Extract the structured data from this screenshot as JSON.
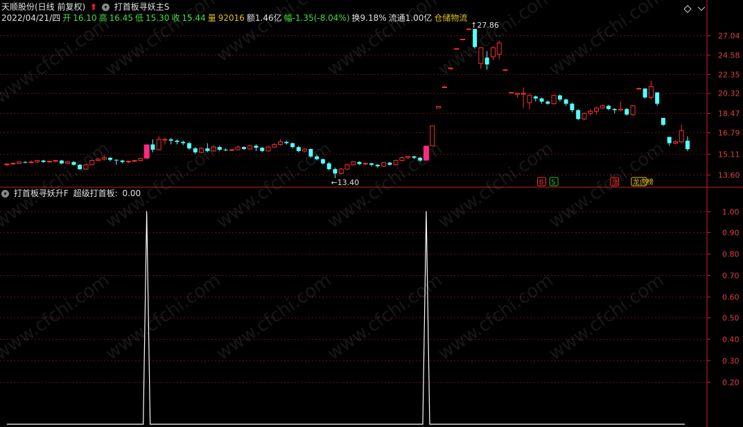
{
  "header": {
    "stock": "天顺股份(日线 前复权)",
    "indicator_main": "打首板寻妖主S",
    "date": "2022/04/21/四",
    "open_label": "开",
    "open": "16.10",
    "high_label": "高",
    "high": "16.45",
    "low_label": "低",
    "low": "15.30",
    "close_label": "收",
    "close": "15.44",
    "vol_label": "量",
    "vol": "92016",
    "amount": "额1.46亿",
    "change": "幅-1.35(-8.04%)",
    "turnover": "换9.18%",
    "float": "流通1.00亿",
    "sector": "仓储物流"
  },
  "sub_header": {
    "indicator": "打首板寻妖升F",
    "param_label": "超级打首板:",
    "param_value": "0.00"
  },
  "colors": {
    "up": "#ff3030",
    "down": "#55ffff",
    "limit": "#ff2a80",
    "axis": "#cc2020",
    "grid": "#6a1010",
    "line": "#ffffff"
  },
  "chart_data": [
    {
      "type": "candlestick",
      "title": "打首板寻妖主S",
      "ylim": [
        12.9,
        28.8
      ],
      "y_ticks": [
        27.04,
        24.58,
        22.35,
        20.32,
        18.47,
        16.79,
        15.11,
        13.6
      ],
      "annotations": [
        {
          "text": "↑27.86",
          "bar": 77
        },
        {
          "text": "←13.40",
          "bar": 54
        }
      ],
      "signals": [
        {
          "text": "B",
          "bar": 88,
          "color": "#ff3030"
        },
        {
          "text": "S",
          "bar": 90,
          "color": "#30c030"
        },
        {
          "text": "涨",
          "bar": 100,
          "color": "#ff3030"
        },
        {
          "text": "龙虎榜",
          "bar": 104,
          "color": "#e0c020"
        }
      ],
      "candles": [
        [
          14.3,
          14.35,
          14.2,
          14.4
        ],
        [
          14.35,
          14.4,
          14.3,
          14.45
        ],
        [
          14.4,
          14.5,
          14.35,
          14.55
        ],
        [
          14.5,
          14.45,
          14.4,
          14.55
        ],
        [
          14.45,
          14.5,
          14.4,
          14.6
        ],
        [
          14.5,
          14.6,
          14.45,
          14.65
        ],
        [
          14.6,
          14.5,
          14.45,
          14.65
        ],
        [
          14.5,
          14.55,
          14.45,
          14.6
        ],
        [
          14.55,
          14.6,
          14.5,
          14.65
        ],
        [
          14.6,
          14.4,
          14.35,
          14.65
        ],
        [
          14.4,
          14.5,
          14.35,
          14.55
        ],
        [
          14.5,
          14.3,
          14.25,
          14.55
        ],
        [
          14.3,
          14.0,
          13.95,
          14.35
        ],
        [
          14.0,
          14.3,
          13.95,
          14.35
        ],
        [
          14.3,
          14.6,
          14.25,
          14.65
        ],
        [
          14.6,
          14.7,
          14.55,
          14.8
        ],
        [
          14.7,
          14.8,
          14.6,
          15.0
        ],
        [
          14.8,
          14.65,
          14.55,
          14.85
        ],
        [
          14.65,
          14.6,
          14.3,
          14.7
        ],
        [
          14.6,
          14.5,
          14.4,
          14.65
        ],
        [
          14.5,
          14.55,
          14.4,
          14.6
        ],
        [
          14.55,
          14.6,
          14.5,
          14.65
        ],
        [
          14.6,
          14.75,
          14.55,
          14.8
        ],
        [
          14.75,
          15.8,
          14.7,
          15.8
        ],
        [
          15.8,
          15.4,
          15.2,
          16.2
        ],
        [
          15.4,
          16.2,
          15.35,
          16.45
        ],
        [
          16.2,
          16.2,
          15.8,
          16.3
        ],
        [
          16.2,
          16.1,
          15.8,
          16.3
        ],
        [
          16.1,
          16.0,
          15.8,
          16.2
        ],
        [
          16.0,
          15.9,
          15.75,
          16.1
        ],
        [
          15.9,
          15.5,
          15.4,
          16.0
        ],
        [
          15.5,
          15.2,
          15.1,
          15.6
        ],
        [
          15.2,
          15.5,
          15.15,
          15.6
        ],
        [
          15.5,
          15.3,
          15.2,
          15.9
        ],
        [
          15.3,
          15.6,
          15.25,
          15.7
        ],
        [
          15.6,
          15.4,
          15.3,
          15.7
        ],
        [
          15.4,
          15.35,
          15.3,
          15.5
        ],
        [
          15.35,
          15.4,
          15.3,
          15.45
        ],
        [
          15.4,
          15.6,
          15.35,
          15.7
        ],
        [
          15.6,
          15.45,
          15.4,
          15.65
        ],
        [
          15.45,
          15.7,
          15.4,
          15.8
        ],
        [
          15.7,
          15.55,
          15.3,
          15.8
        ],
        [
          15.55,
          15.3,
          15.2,
          15.6
        ],
        [
          15.3,
          15.6,
          15.25,
          15.7
        ],
        [
          15.6,
          15.8,
          15.55,
          15.9
        ],
        [
          15.8,
          16.0,
          15.7,
          16.2
        ],
        [
          16.0,
          15.9,
          15.8,
          16.1
        ],
        [
          15.9,
          15.6,
          15.5,
          15.95
        ],
        [
          15.6,
          15.3,
          15.2,
          15.7
        ],
        [
          15.3,
          15.45,
          15.2,
          15.5
        ],
        [
          15.45,
          14.9,
          14.8,
          15.5
        ],
        [
          14.9,
          14.7,
          14.6,
          15.0
        ],
        [
          14.7,
          14.4,
          14.3,
          14.75
        ],
        [
          14.4,
          14.0,
          13.9,
          14.5
        ],
        [
          14.0,
          13.7,
          13.4,
          14.1
        ],
        [
          13.7,
          14.0,
          13.65,
          14.1
        ],
        [
          14.0,
          14.3,
          13.95,
          14.4
        ],
        [
          14.3,
          14.5,
          14.25,
          14.55
        ],
        [
          14.5,
          14.35,
          14.3,
          14.55
        ],
        [
          14.35,
          14.4,
          14.3,
          14.45
        ],
        [
          14.4,
          14.3,
          14.2,
          14.45
        ],
        [
          14.3,
          14.2,
          14.1,
          14.35
        ],
        [
          14.2,
          14.45,
          14.15,
          14.5
        ],
        [
          14.45,
          14.3,
          14.25,
          14.5
        ],
        [
          14.3,
          14.6,
          14.25,
          14.65
        ],
        [
          14.6,
          14.8,
          14.55,
          14.9
        ],
        [
          14.8,
          14.9,
          14.7,
          14.95
        ],
        [
          14.9,
          14.8,
          14.7,
          14.95
        ],
        [
          14.8,
          14.6,
          14.5,
          14.85
        ],
        [
          14.6,
          15.7,
          14.6,
          15.7
        ],
        [
          15.7,
          17.3,
          15.7,
          17.3
        ],
        [
          18.9,
          19.05,
          18.9,
          19.05
        ],
        [
          20.95,
          20.95,
          20.9,
          21.1
        ],
        [
          23.0,
          23.0,
          23.0,
          23.0
        ],
        [
          25.3,
          25.3,
          25.3,
          25.3
        ],
        [
          26.5,
          26.5,
          26.5,
          26.5
        ],
        [
          27.86,
          27.86,
          27.86,
          27.86
        ],
        [
          27.86,
          25.5,
          25.3,
          27.86
        ],
        [
          23.5,
          25.4,
          22.9,
          25.5
        ],
        [
          24.2,
          23.4,
          22.8,
          25.0
        ],
        [
          24.3,
          25.4,
          23.9,
          25.6
        ],
        [
          24.6,
          26.0,
          24.0,
          26.3
        ],
        [
          22.8,
          22.8,
          22.8,
          22.8
        ],
        [
          20.4,
          20.4,
          20.4,
          20.4
        ],
        [
          20.2,
          20.3,
          19.9,
          20.4
        ],
        [
          20.3,
          20.3,
          18.9,
          20.9
        ],
        [
          19.4,
          20.1,
          18.8,
          20.3
        ],
        [
          20.0,
          19.8,
          19.5,
          20.1
        ],
        [
          19.8,
          19.5,
          19.3,
          19.9
        ],
        [
          19.5,
          19.3,
          19.2,
          19.6
        ],
        [
          19.3,
          20.1,
          19.2,
          20.2
        ],
        [
          20.1,
          19.7,
          19.5,
          20.2
        ],
        [
          19.7,
          19.3,
          19.1,
          19.8
        ],
        [
          19.3,
          18.7,
          18.5,
          19.4
        ],
        [
          18.7,
          17.9,
          17.8,
          18.8
        ],
        [
          17.9,
          18.4,
          17.8,
          18.5
        ],
        [
          18.4,
          18.6,
          18.2,
          18.8
        ],
        [
          18.6,
          18.9,
          18.3,
          19.0
        ],
        [
          18.9,
          19.1,
          18.8,
          19.2
        ],
        [
          19.1,
          18.8,
          18.7,
          19.2
        ],
        [
          18.8,
          18.7,
          18.4,
          18.9
        ],
        [
          18.7,
          18.8,
          18.6,
          19.5
        ],
        [
          18.8,
          18.3,
          18.2,
          18.9
        ],
        [
          18.3,
          19.1,
          18.2,
          19.2
        ],
        [
          20.8,
          20.8,
          20.7,
          20.9
        ],
        [
          20.8,
          19.9,
          19.8,
          20.8
        ],
        [
          19.9,
          21.0,
          19.7,
          21.6
        ],
        [
          20.4,
          19.3,
          19.1,
          20.4
        ],
        [
          18.0,
          17.4,
          17.3,
          18.0
        ],
        [
          16.4,
          15.9,
          15.7,
          16.4
        ],
        [
          15.9,
          16.0,
          15.8,
          16.1
        ],
        [
          16.0,
          16.9,
          15.9,
          17.4
        ],
        [
          16.1,
          15.44,
          15.3,
          16.45
        ]
      ]
    },
    {
      "type": "line",
      "title": "打首板寻妖升F",
      "ylim": [
        0,
        1.08
      ],
      "y_ticks": [
        1.0,
        0.9,
        0.8,
        0.7,
        0.6,
        0.5,
        0.4,
        0.3,
        0.2
      ],
      "spike_bars": [
        23,
        69
      ],
      "n_bars": 114
    }
  ],
  "watermark": "www.cfchi.com"
}
